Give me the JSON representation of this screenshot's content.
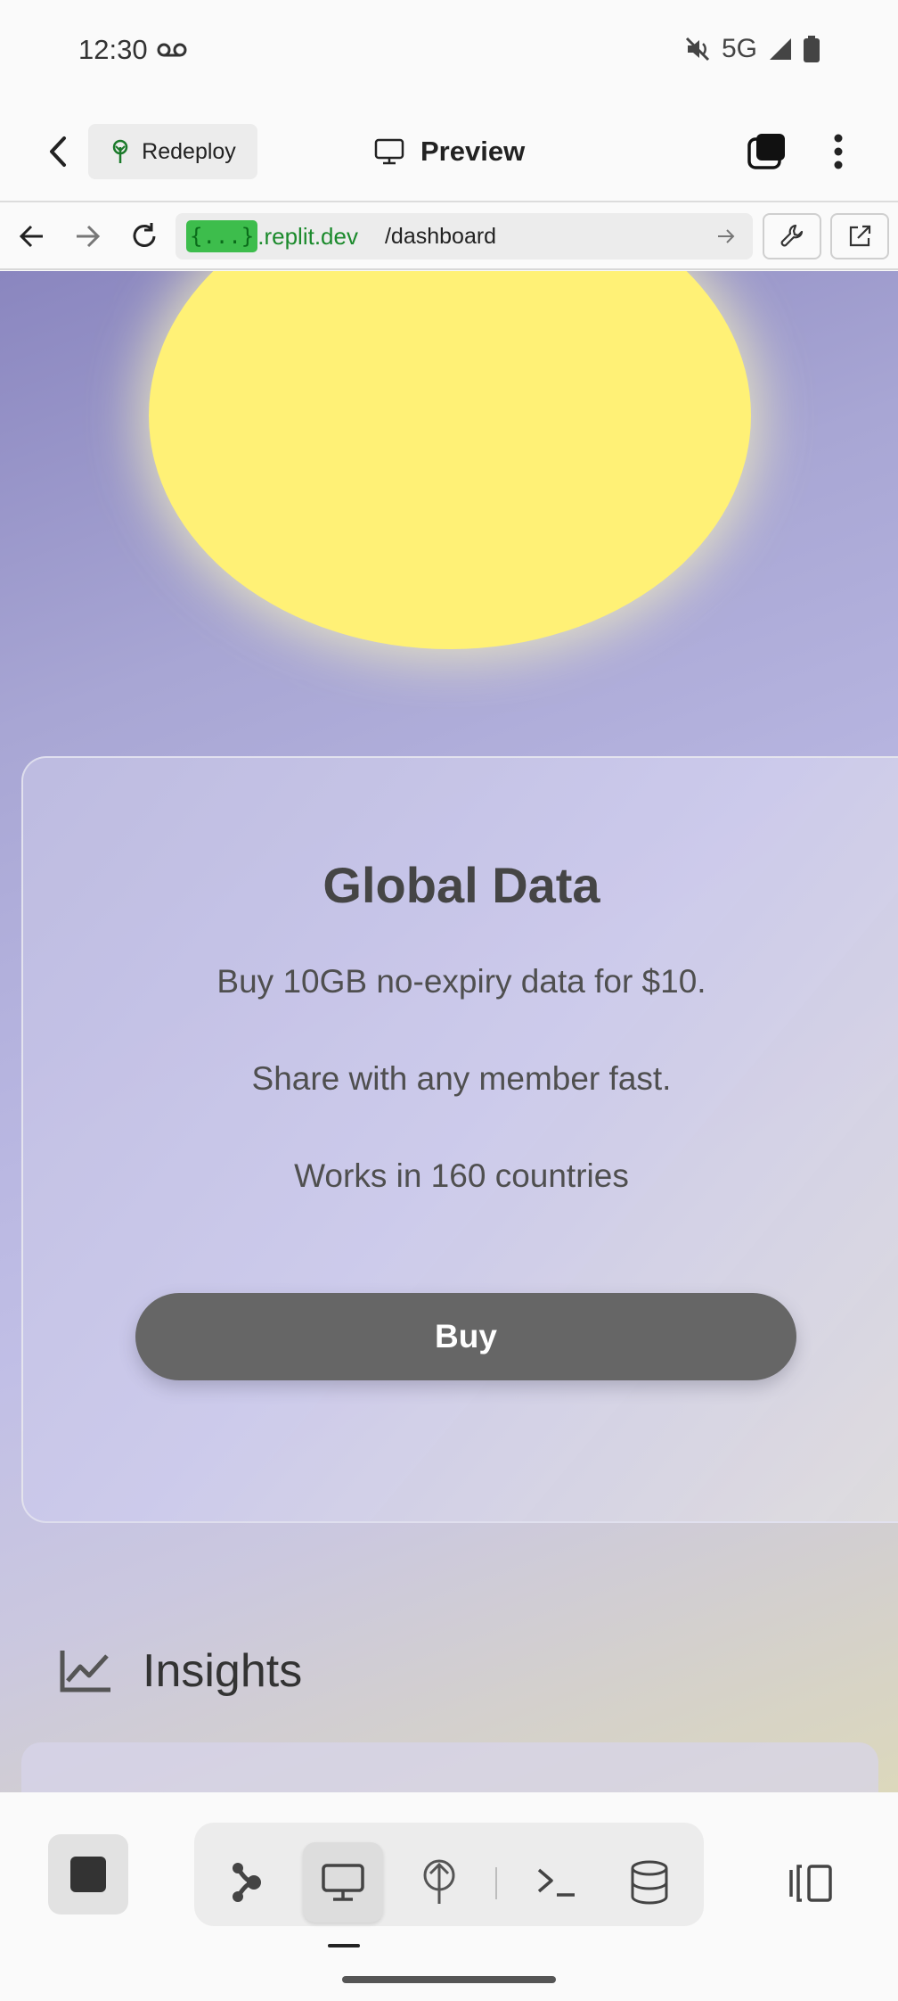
{
  "status_bar": {
    "time": "12:30",
    "network": "5G",
    "icons": [
      "voicemail-icon",
      "mute-icon",
      "signal-icon",
      "battery-icon"
    ]
  },
  "header": {
    "redeploy_label": "Redeploy",
    "title": "Preview"
  },
  "browser": {
    "domain_tag": "{...}",
    "domain": ".replit.dev",
    "path": "/dashboard"
  },
  "card": {
    "title": "Global Data",
    "lines": [
      "Buy 10GB no-expiry data for $10.",
      "Share with any member fast.",
      "Works in 160 countries"
    ],
    "button_label": "Buy"
  },
  "insights": {
    "label": "Insights"
  },
  "colors": {
    "sun": "#fff176",
    "buy_button": "#666666",
    "domain_tag_bg": "#3dbd4c",
    "domain_text": "#1b8a2c"
  },
  "bottom_toolbar": {
    "icons": [
      "stop-icon",
      "agent-icon",
      "preview-icon",
      "deploy-icon",
      "shell-icon",
      "database-icon",
      "side-panel-icon"
    ],
    "active": "preview-icon"
  }
}
